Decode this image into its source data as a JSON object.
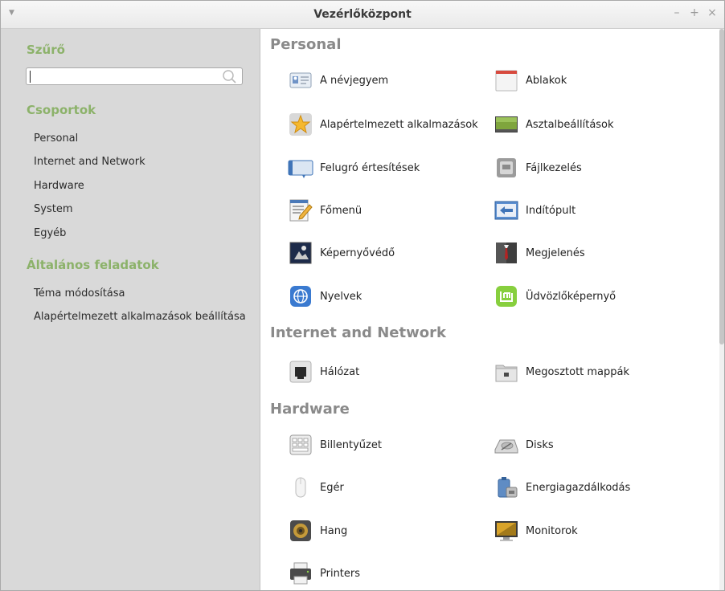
{
  "window": {
    "title": "Vezérlőközpont"
  },
  "sidebar": {
    "filter_heading": "Szűrő",
    "search_value": "",
    "groups_heading": "Csoportok",
    "groups": [
      "Personal",
      "Internet and Network",
      "Hardware",
      "System",
      "Egyéb"
    ],
    "tasks_heading": "Általános feladatok",
    "tasks": [
      "Téma módosítása",
      "Alapértelmezett alkalmazások beállítása"
    ]
  },
  "content": {
    "sections": [
      {
        "title": "Personal",
        "items": [
          {
            "label": "A névjegyem",
            "icon": "about-me-icon"
          },
          {
            "label": "Ablakok",
            "icon": "windows-icon"
          },
          {
            "label": "Alapértelmezett alkalmazások",
            "icon": "default-apps-icon"
          },
          {
            "label": "Asztalbeállítások",
            "icon": "desktop-settings-icon"
          },
          {
            "label": "Felugró értesítések",
            "icon": "notifications-icon"
          },
          {
            "label": "Fájlkezelés",
            "icon": "file-management-icon"
          },
          {
            "label": "Főmenü",
            "icon": "main-menu-icon"
          },
          {
            "label": "Indítópult",
            "icon": "panel-icon"
          },
          {
            "label": "Képernyővédő",
            "icon": "screensaver-icon"
          },
          {
            "label": "Megjelenés",
            "icon": "appearance-icon"
          },
          {
            "label": "Nyelvek",
            "icon": "languages-icon"
          },
          {
            "label": "Üdvözlőképernyő",
            "icon": "login-window-icon"
          }
        ]
      },
      {
        "title": "Internet and Network",
        "items": [
          {
            "label": "Hálózat",
            "icon": "network-icon"
          },
          {
            "label": "Megosztott mappák",
            "icon": "shared-folders-icon"
          }
        ]
      },
      {
        "title": "Hardware",
        "items": [
          {
            "label": "Billentyűzet",
            "icon": "keyboard-icon"
          },
          {
            "label": "Disks",
            "icon": "disks-icon"
          },
          {
            "label": "Egér",
            "icon": "mouse-icon"
          },
          {
            "label": "Energiagazdálkodás",
            "icon": "power-icon"
          },
          {
            "label": "Hang",
            "icon": "sound-icon"
          },
          {
            "label": "Monitorok",
            "icon": "monitors-icon"
          },
          {
            "label": "Printers",
            "icon": "printer-icon"
          }
        ]
      }
    ]
  },
  "colors": {
    "heading_green": "#8cb26a",
    "section_gray": "#8a8a8a",
    "sidebar_bg": "#d9d9d9"
  }
}
